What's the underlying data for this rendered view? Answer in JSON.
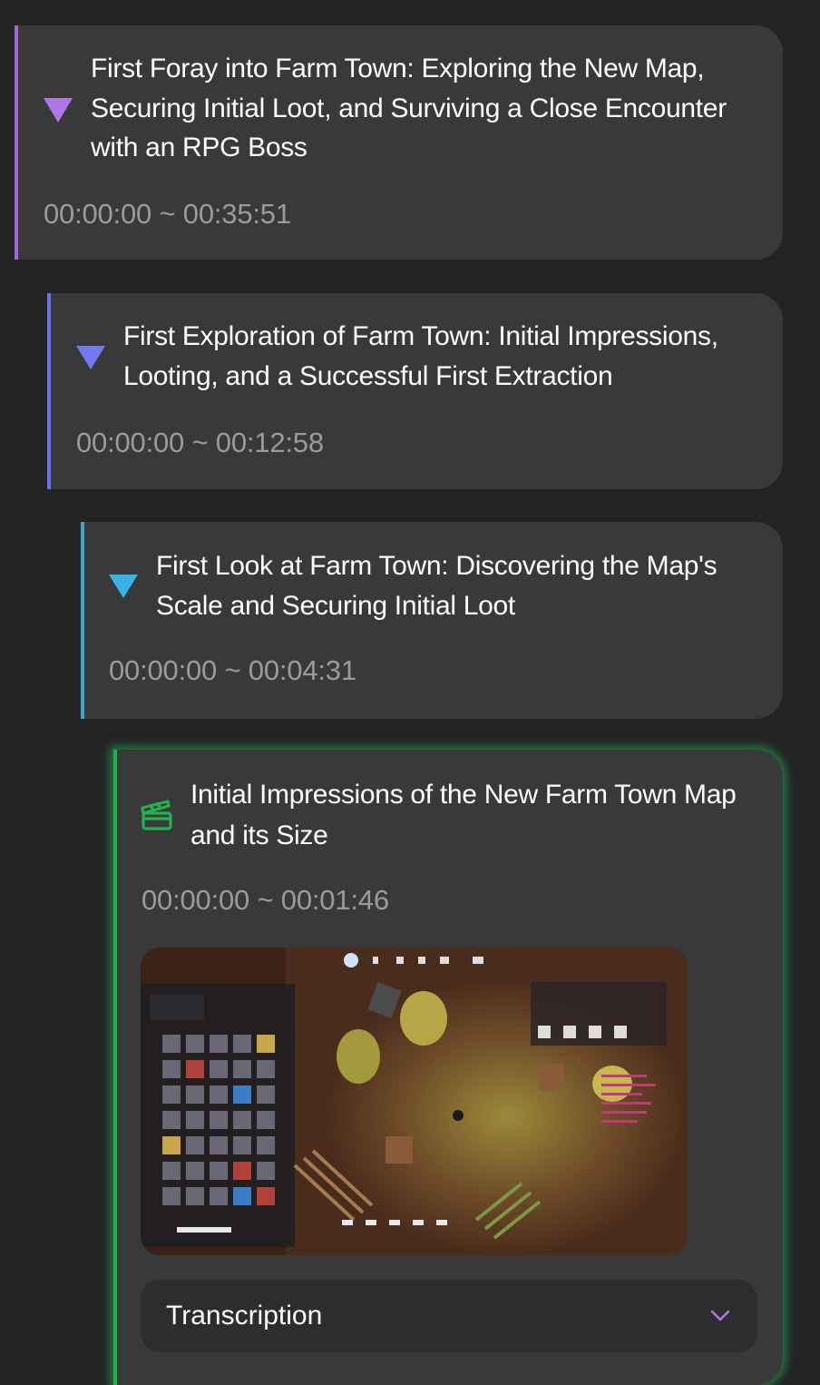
{
  "segments": [
    {
      "title": "First Foray into Farm Town: Exploring the New Map, Securing Initial Loot, and Surviving a Close Encounter with an RPG Boss",
      "time": "00:00:00 ~ 00:35:51",
      "accent": "#a066d8"
    },
    {
      "title": "First Exploration of Farm Town: Initial Impressions, Looting, and a Successful First Extraction",
      "time": "00:00:00 ~ 00:12:58",
      "accent": "#6c71e8"
    },
    {
      "title": "First Look at Farm Town: Discovering the Map's Scale and Securing Initial Loot",
      "time": "00:00:00 ~ 00:04:31",
      "accent": "#34a6d9"
    },
    {
      "title": "Initial Impressions of the New Farm Town Map and its Size",
      "time": "00:00:00 ~ 00:01:46",
      "accent": "#22b14c",
      "icon": "clapperboard-icon",
      "thumbnail": "gameplay-thumbnail",
      "transcription_label": "Transcription"
    }
  ]
}
